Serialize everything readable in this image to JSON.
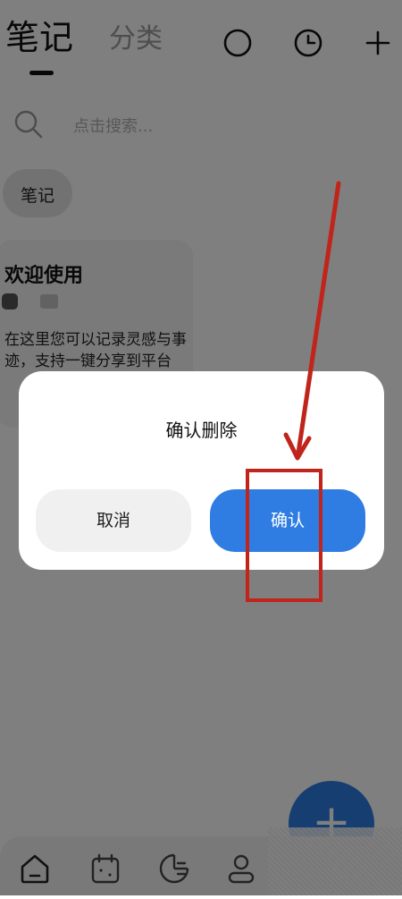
{
  "header": {
    "tab_notes": "笔记",
    "tab_category": "分类",
    "icons": [
      "circle-icon",
      "clock-icon",
      "plus-icon"
    ]
  },
  "search": {
    "placeholder": "点击搜索..."
  },
  "chip": {
    "label": "笔记"
  },
  "note_card": {
    "title": "欢迎使用",
    "body": "在这里您可以记录灵感与事迹，支持一键分享到平台"
  },
  "fab": {
    "label": "+"
  },
  "bottom_nav": {
    "items": [
      "home-icon",
      "calendar-icon",
      "stats-icon",
      "profile-icon"
    ]
  },
  "dialog": {
    "title": "确认删除",
    "cancel_label": "取消",
    "confirm_label": "确认"
  },
  "colors": {
    "accent": "#2f7de2",
    "annotation": "#c0241a",
    "overlay": "rgba(0,0,0,0.5)"
  }
}
